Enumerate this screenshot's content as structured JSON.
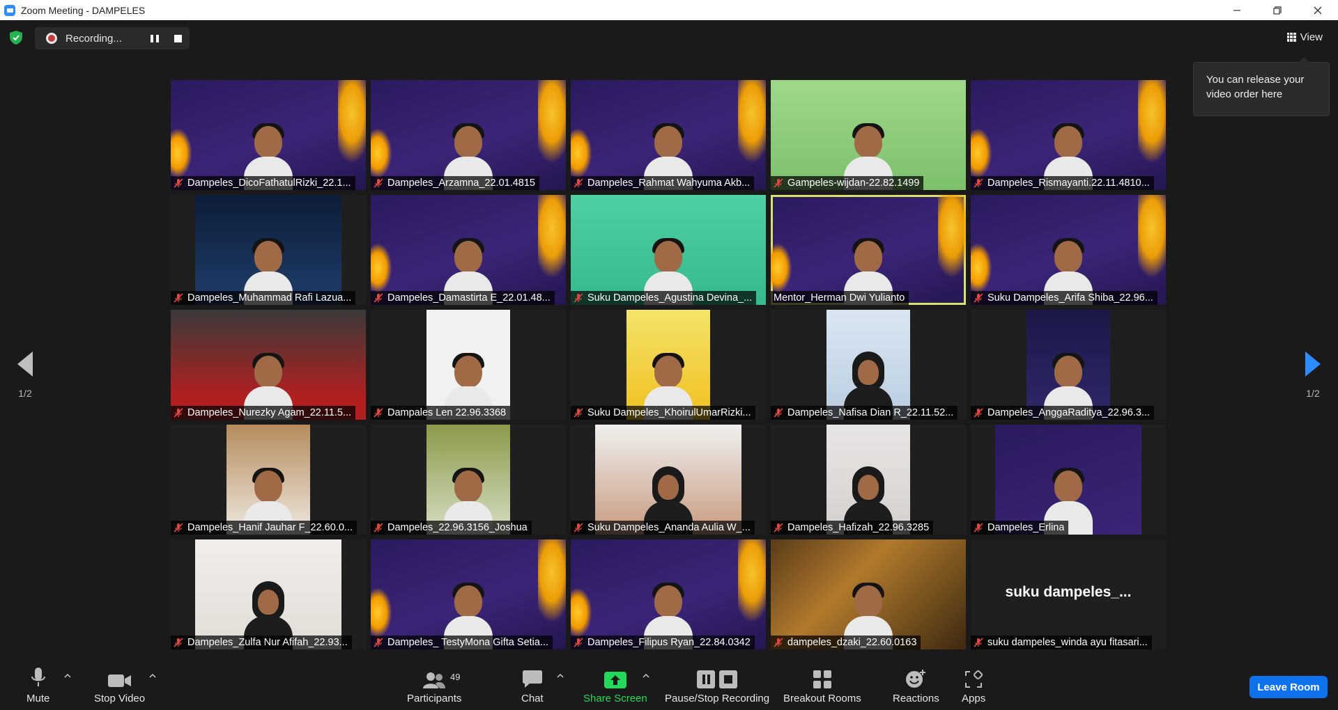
{
  "window": {
    "title": "Zoom Meeting - DAMPELES",
    "controls": [
      "minimize",
      "restore",
      "close"
    ]
  },
  "recording": {
    "label": "Recording...",
    "pause_icon": "pause-icon",
    "stop_icon": "stop-icon"
  },
  "view_button": {
    "label": "View"
  },
  "tooltip": {
    "text": "You can release your video order here"
  },
  "pagination": {
    "left": "1/2",
    "right": "1/2"
  },
  "participants": [
    {
      "name": "Dampeles_DicoFathatulRizki_22.1...",
      "muted": true,
      "bg": "purple"
    },
    {
      "name": "Dampeles_Arzamna_22.01.4815",
      "muted": true,
      "bg": "purple"
    },
    {
      "name": "Dampeles_Rahmat Wahyuma Akb...",
      "muted": true,
      "bg": "purple"
    },
    {
      "name": "Gampeles-wijdan-22.82.1499",
      "muted": true,
      "bg": "green"
    },
    {
      "name": "Dampeles_Rismayanti.22.11.4810...",
      "muted": true,
      "bg": "purple"
    },
    {
      "name": "Dampeles_Muhammad Rafi Lazua...",
      "muted": true,
      "bg": "blue"
    },
    {
      "name": "Dampeles_Damastirta E_22.01.48...",
      "muted": true,
      "bg": "purple"
    },
    {
      "name": "Suku Dampeles_Agustina Devina_...",
      "muted": true,
      "bg": "teal"
    },
    {
      "name": "Mentor_Herman Dwi Yulianto",
      "muted": false,
      "bg": "purple",
      "active": true
    },
    {
      "name": "Suku Dampeles_Arifa Shiba_22.96...",
      "muted": true,
      "bg": "purple"
    },
    {
      "name": "Dampeles_Nurezky Agam_22.11.5...",
      "muted": true,
      "bg": "red"
    },
    {
      "name": "Dampales Len 22.96.3368",
      "muted": true,
      "bg": "white"
    },
    {
      "name": "Suku Dampeles_KhoirulUmarRizki...",
      "muted": true,
      "bg": "yellow"
    },
    {
      "name": "Dampeles_Nafisa Dian R_22.11.52...",
      "muted": true,
      "bg": "lightblue"
    },
    {
      "name": "Dampeles_AnggaRaditya_22.96.3...",
      "muted": true,
      "bg": "navy"
    },
    {
      "name": "Dampeles_Hanif Jauhar F_22.60.0...",
      "muted": true,
      "bg": "wood"
    },
    {
      "name": "Dampeles_22.96.3156_Joshua",
      "muted": true,
      "bg": "olive"
    },
    {
      "name": "Suku Dampeles_Ananda Aulia W_...",
      "muted": true,
      "bg": "room"
    },
    {
      "name": "Dampeles_Hafizah_22.96.3285",
      "muted": true,
      "bg": "grey"
    },
    {
      "name": "Dampeles_Erlina",
      "muted": true,
      "bg": "blackbars"
    },
    {
      "name": "Dampeles_Zulfa Nur Afifah_22.93...",
      "muted": true,
      "bg": "pale"
    },
    {
      "name": "Dampeles_ TestyMona Gifta Setia...",
      "muted": true,
      "bg": "purple"
    },
    {
      "name": "Dampeles_Filipus Ryan_22.84.0342",
      "muted": true,
      "bg": "purple"
    },
    {
      "name": "dampeles_dzaki_22.60.0163",
      "muted": true,
      "bg": "art"
    },
    {
      "name": "suku dampeles_winda ayu fitasari...",
      "muted": true,
      "bg": "none",
      "big_label": "suku  dampeles_..."
    }
  ],
  "toolbar": {
    "mute": "Mute",
    "stop_video": "Stop Video",
    "participants": "Participants",
    "participants_count": "49",
    "chat": "Chat",
    "share_screen": "Share Screen",
    "recording": "Pause/Stop Recording",
    "breakout": "Breakout Rooms",
    "reactions": "Reactions",
    "apps": "Apps",
    "leave": "Leave Room"
  },
  "colors": {
    "accent": "#2d8cff",
    "share_green": "#23d959",
    "active_speaker": "#d8e269",
    "mute_red": "#e0483e",
    "leave_blue": "#0e72ed"
  }
}
